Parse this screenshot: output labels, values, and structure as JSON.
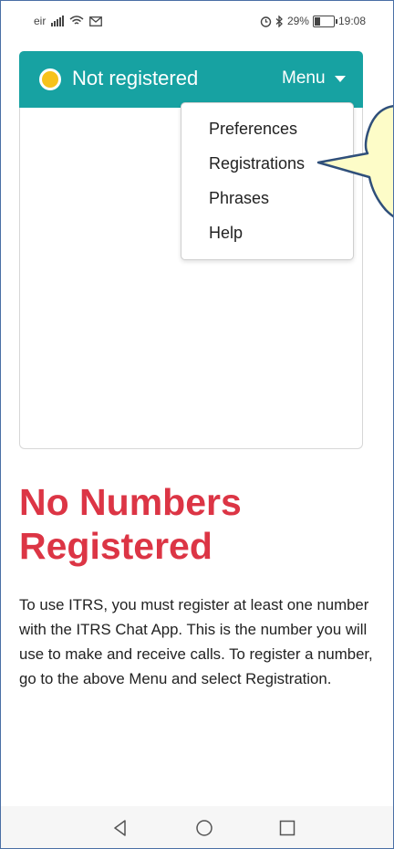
{
  "status_bar": {
    "carrier": "eir",
    "battery_percent": "29%",
    "battery_level": 0.29,
    "time": "19:08",
    "icons": [
      "signal-icon",
      "wifi-icon",
      "mail-icon",
      "alarm-icon",
      "bluetooth-icon",
      "battery-icon"
    ]
  },
  "header": {
    "registration_status": "Not registered",
    "status_color": "#f7c21b",
    "bar_color": "#17a2a2",
    "menu_label": "Menu"
  },
  "menu": {
    "items": [
      {
        "label": "Preferences"
      },
      {
        "label": "Registrations"
      },
      {
        "label": "Phrases"
      },
      {
        "label": "Help"
      }
    ]
  },
  "main": {
    "heading_line1": "No Numbers",
    "heading_line2": "Registered",
    "heading_color": "#dc3545",
    "paragraph": "To use ITRS, you must register at least one number with the ITRS Chat App. This is the number you will use to make and receive calls. To register a number, go to the above Menu and select Registration."
  },
  "nav_bar": {
    "icons": [
      "back-icon",
      "home-icon",
      "recents-icon"
    ]
  }
}
